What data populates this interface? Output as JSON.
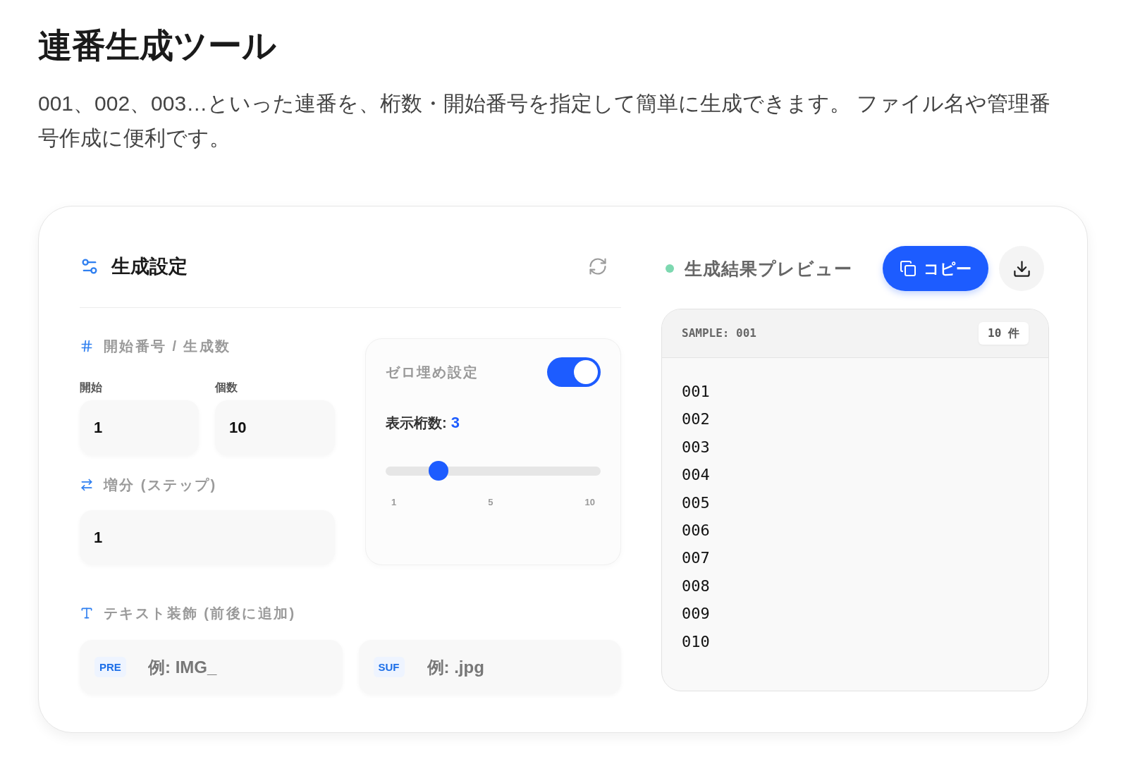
{
  "title": "連番生成ツール",
  "description": "001、002、003…といった連番を、桁数・開始番号を指定して簡単に生成できます。 ファイル名や管理番号作成に便利です。",
  "settings": {
    "title": "生成設定",
    "range": {
      "label": "開始番号 / 生成数",
      "fields": [
        {
          "label": "開始",
          "value": "1"
        },
        {
          "label": "個数",
          "value": "10"
        }
      ]
    },
    "step": {
      "label": "増分 (ステップ)",
      "value": "1"
    },
    "zero_padding": {
      "label": "ゼロ埋め設定",
      "on": true,
      "digits_label": "表示桁数:",
      "digits_value": "3",
      "level": 0.222,
      "ticks": [
        "1",
        "5",
        "10"
      ]
    },
    "decoration": {
      "label": "テキスト装飾 (前後に追加)",
      "fields": [
        {
          "tag": "PRE",
          "placeholder": "例: IMG_"
        },
        {
          "tag": "SUF",
          "placeholder": "例: .jpg"
        }
      ]
    }
  },
  "preview": {
    "title": "生成結果プレビュー",
    "copy_button": "コピー",
    "sample": "SAMPLE: 001",
    "count": "10 件",
    "items": [
      "001",
      "002",
      "003",
      "004",
      "005",
      "006",
      "007",
      "008",
      "009",
      "010"
    ]
  }
}
